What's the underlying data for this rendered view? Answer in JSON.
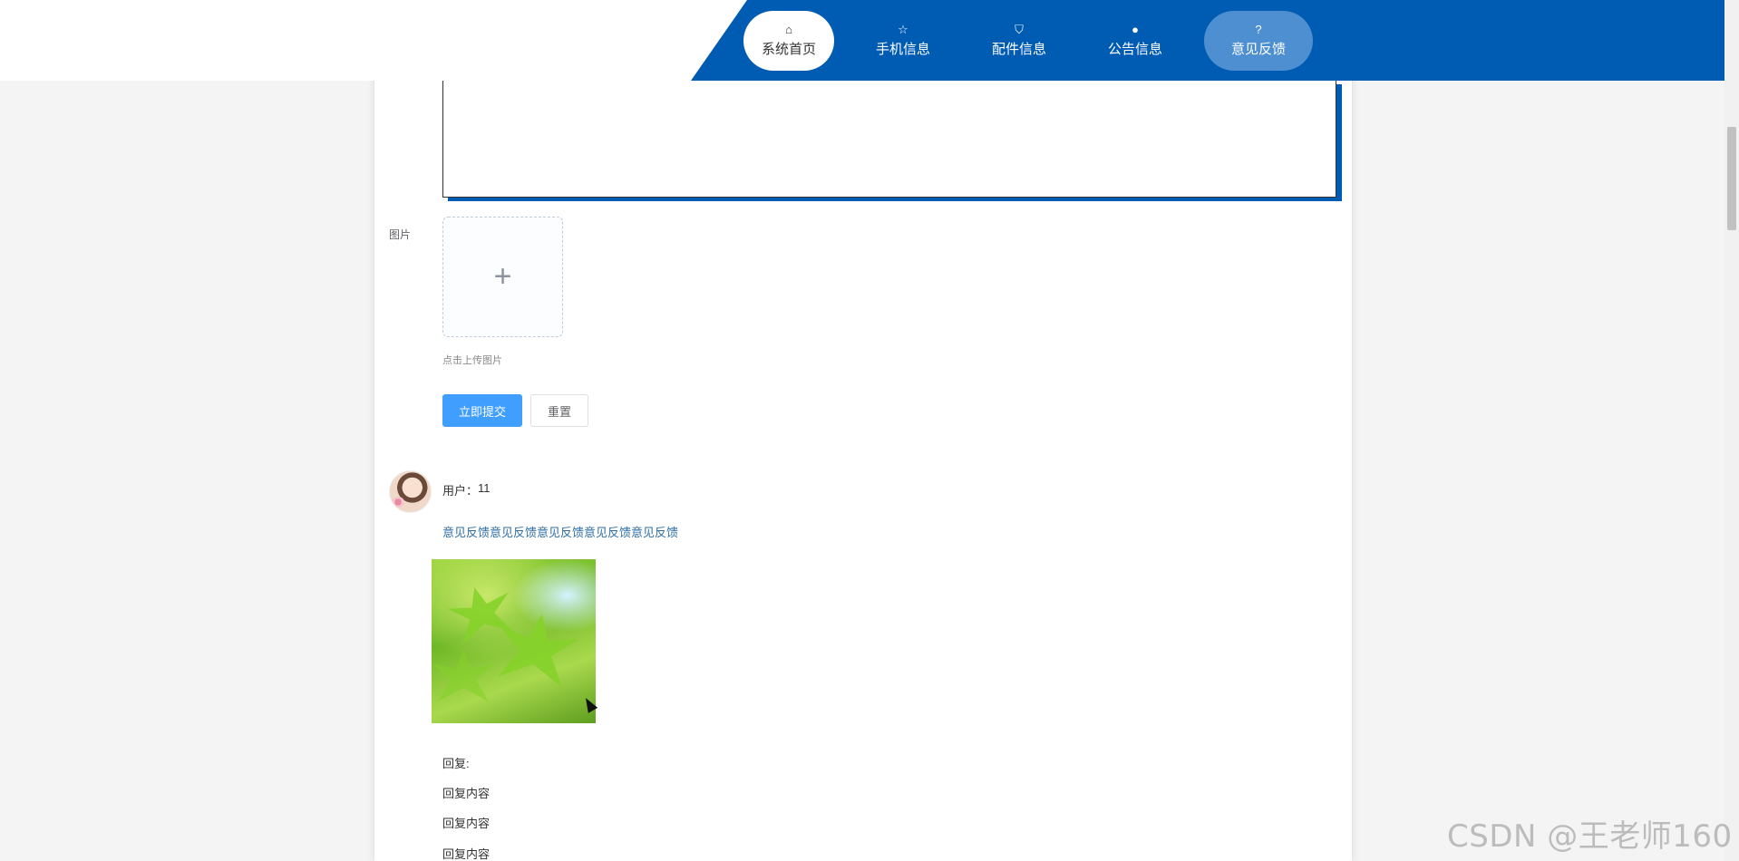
{
  "nav": {
    "items": [
      {
        "label": "系统首页",
        "icon": "home-icon",
        "glyph": "⌂"
      },
      {
        "label": "手机信息",
        "icon": "star-icon",
        "glyph": "☆"
      },
      {
        "label": "配件信息",
        "icon": "bag-icon",
        "glyph": "⛉"
      },
      {
        "label": "公告信息",
        "icon": "alert-icon",
        "glyph": "●"
      },
      {
        "label": "意见反馈",
        "icon": "question-icon",
        "glyph": "?"
      }
    ]
  },
  "form": {
    "image_label": "图片",
    "upload_plus": "+",
    "upload_tip": "点击上传图片",
    "submit_label": "立即提交",
    "reset_label": "重置"
  },
  "feedback": {
    "user_prefix": "用户：",
    "user_name": "11",
    "content": "意见反馈意见反馈意见反馈意见反馈意见反馈",
    "reply_title": "回复:",
    "replies": [
      "回复内容",
      "回复内容",
      "回复内容"
    ]
  },
  "watermark": "CSDN @王老师160",
  "colors": {
    "nav_blue": "#005bb3",
    "nav_active": "#4d8fd1",
    "primary_button": "#409eff",
    "feedback_link": "#2d6da3"
  }
}
